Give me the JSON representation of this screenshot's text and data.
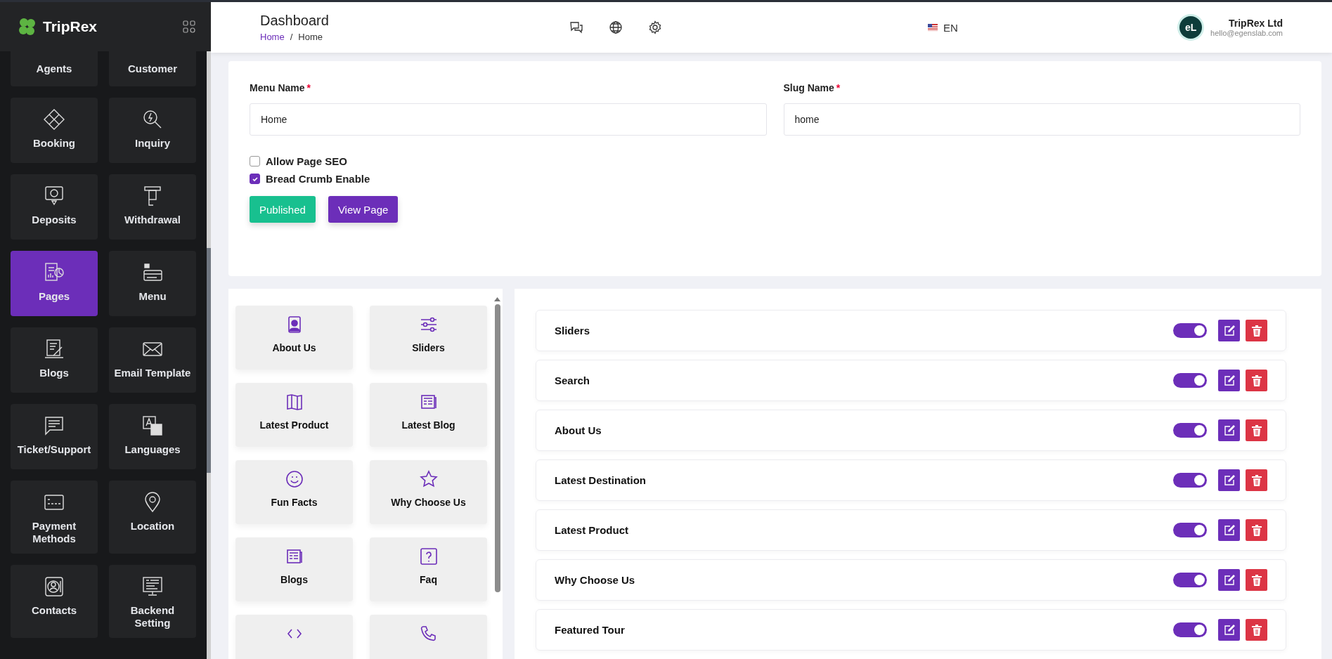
{
  "brand": {
    "name": "TripRex"
  },
  "sidebar": {
    "items": [
      {
        "label": "Agents",
        "selected": false
      },
      {
        "label": "Customer",
        "selected": false
      },
      {
        "label": "Booking",
        "selected": false
      },
      {
        "label": "Inquiry",
        "selected": false
      },
      {
        "label": "Deposits",
        "selected": false
      },
      {
        "label": "Withdrawal",
        "selected": false
      },
      {
        "label": "Pages",
        "selected": true
      },
      {
        "label": "Menu",
        "selected": false
      },
      {
        "label": "Blogs",
        "selected": false
      },
      {
        "label": "Email Template",
        "selected": false
      },
      {
        "label": "Ticket/Support",
        "selected": false
      },
      {
        "label": "Languages",
        "selected": false
      },
      {
        "label": "Payment Methods",
        "selected": false
      },
      {
        "label": "Location",
        "selected": false
      },
      {
        "label": "Contacts",
        "selected": false
      },
      {
        "label": "Backend Setting",
        "selected": false
      }
    ]
  },
  "header": {
    "title": "Dashboard",
    "breadcrumb": [
      "Home",
      "/",
      "Home"
    ],
    "language": "EN",
    "user": {
      "initials": "eL",
      "name": "TripRex Ltd",
      "email": "hello@egenslab.com"
    }
  },
  "form": {
    "fields": [
      {
        "label": "Menu Name",
        "required_mark": "*",
        "value": "Home"
      },
      {
        "label": "Slug Name",
        "required_mark": "*",
        "value": "home"
      }
    ],
    "checkboxes": [
      {
        "label": "Allow Page SEO",
        "checked": false
      },
      {
        "label": "Bread Crumb Enable",
        "checked": true
      }
    ],
    "buttons": [
      {
        "label": "Published",
        "kind": "success"
      },
      {
        "label": "View Page",
        "kind": "primary"
      }
    ]
  },
  "widgets": [
    {
      "label": "About Us"
    },
    {
      "label": "Sliders"
    },
    {
      "label": "Latest Product"
    },
    {
      "label": "Latest Blog"
    },
    {
      "label": "Fun Facts"
    },
    {
      "label": "Why Choose Us"
    },
    {
      "label": "Blogs"
    },
    {
      "label": "Faq"
    }
  ],
  "sections": [
    {
      "label": "Sliders",
      "on": true
    },
    {
      "label": "Search",
      "on": true
    },
    {
      "label": "About Us",
      "on": true
    },
    {
      "label": "Latest Destination",
      "on": true
    },
    {
      "label": "Latest Product",
      "on": true
    },
    {
      "label": "Why Choose Us",
      "on": true
    },
    {
      "label": "Featured Tour",
      "on": true
    }
  ]
}
